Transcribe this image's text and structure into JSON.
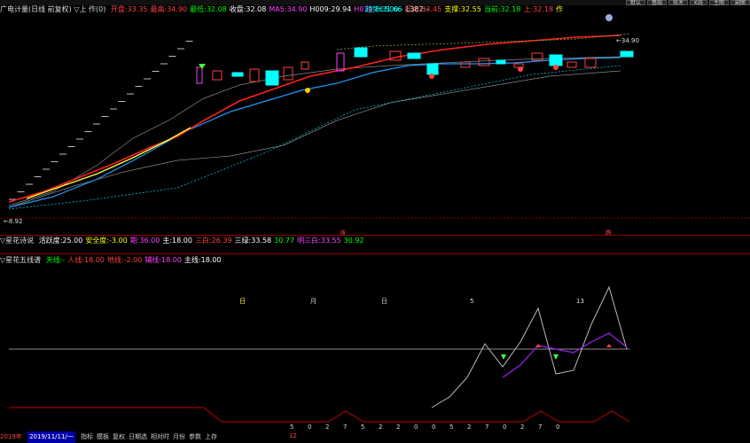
{
  "top_tabs": [
    "默认",
    "基础",
    "技术",
    "K线",
    "主图",
    "副图"
  ],
  "header": {
    "title": "广电计量(日线 前复权) ▽上 作(0)",
    "fields": [
      {
        "label": "开盘",
        "value": "33.35",
        "color": "#ff4040"
      },
      {
        "label": "最高",
        "value": "34.90",
        "color": "#ff4040"
      },
      {
        "label": "最低",
        "value": "32.08",
        "color": "#00ff00"
      },
      {
        "label": "收盘",
        "value": "32.08",
        "color": "#ffffff"
      },
      {
        "label": "MA5",
        "value": "34.90",
        "color": "#ff40ff"
      },
      {
        "label": "H009",
        "value": "29.94",
        "color": "#ffffff"
      },
      {
        "label": "H018",
        "value": "",
        "color": "#ff40ff"
      },
      {
        "label": "HL500",
        "value": "-",
        "color": "#00ffff"
      },
      {
        "label": "L382",
        "value": "-",
        "color": "#ffffff"
      }
    ],
    "right_fields": [
      {
        "label": "趋势",
        "value": "31.66",
        "color": "#00ffff"
      },
      {
        "label": "压力",
        "value": "33.45",
        "color": "#ff4040"
      },
      {
        "label": "支撑",
        "value": "32.55",
        "color": "#ffff00"
      },
      {
        "label": "当前",
        "value": "32.18",
        "color": "#00ff00"
      },
      {
        "label": "上",
        "value": "32.18",
        "color": "#ff4040"
      },
      {
        "label": "作",
        "value": "",
        "color": "#ffff00"
      }
    ]
  },
  "main_chart": {
    "price_high_label": "34.90",
    "price_low_label": "8.92",
    "marks": [
      "涨",
      "跌"
    ]
  },
  "indicator1": {
    "title": "▽星花诗说",
    "items": [
      {
        "label": "活跃度",
        "value": "25.00",
        "color": "#ffffff"
      },
      {
        "label": "安全度",
        "value": "-3.00",
        "color": "#ffff00"
      },
      {
        "label": "期",
        "value": "36.00",
        "color": "#ff40ff"
      },
      {
        "label": "主",
        "value": "18.00",
        "color": "#ffffff"
      },
      {
        "label": "三白",
        "value": "26.39",
        "color": "#ff4040"
      },
      {
        "label": "三绿",
        "value": "33.58",
        "color": "#ffffff"
      },
      {
        "label": "",
        "value": "30.77",
        "color": "#00ff00"
      },
      {
        "label": "明三白",
        "value": "33.55",
        "color": "#ff40ff"
      },
      {
        "label": "",
        "value": "30.92",
        "color": "#00ff00"
      }
    ]
  },
  "indicator2": {
    "title": "▽星花五线谱",
    "items": [
      {
        "label": "天线",
        "value": "-",
        "color": "#00ff00"
      },
      {
        "label": "人线",
        "value": "18.00",
        "color": "#ff4040"
      },
      {
        "label": "地线",
        "value": "-2.00",
        "color": "#ff4040"
      },
      {
        "label": "辅线",
        "value": "18.00",
        "color": "#ff40ff"
      },
      {
        "label": "主线",
        "value": "18.00",
        "color": "#ffffff"
      }
    ],
    "char_row": [
      "日",
      "",
      "",
      "",
      "月",
      "",
      "",
      "",
      "日",
      "",
      "",
      "",
      "",
      "5",
      "",
      "",
      "",
      "",
      "",
      "13",
      ""
    ],
    "num_row": [
      "5",
      "0",
      "2",
      "7",
      "5",
      "2",
      "2",
      "0",
      "0",
      "5",
      "2",
      "7",
      "0",
      "2",
      "7",
      "0"
    ],
    "date_left": "2019年",
    "date_value": "2019/11/11/一",
    "date_day": "12"
  },
  "bottom_bar": [
    "指标",
    "模板",
    "复权",
    "日期选",
    "相对时",
    "月份",
    "参数",
    "上存"
  ]
}
